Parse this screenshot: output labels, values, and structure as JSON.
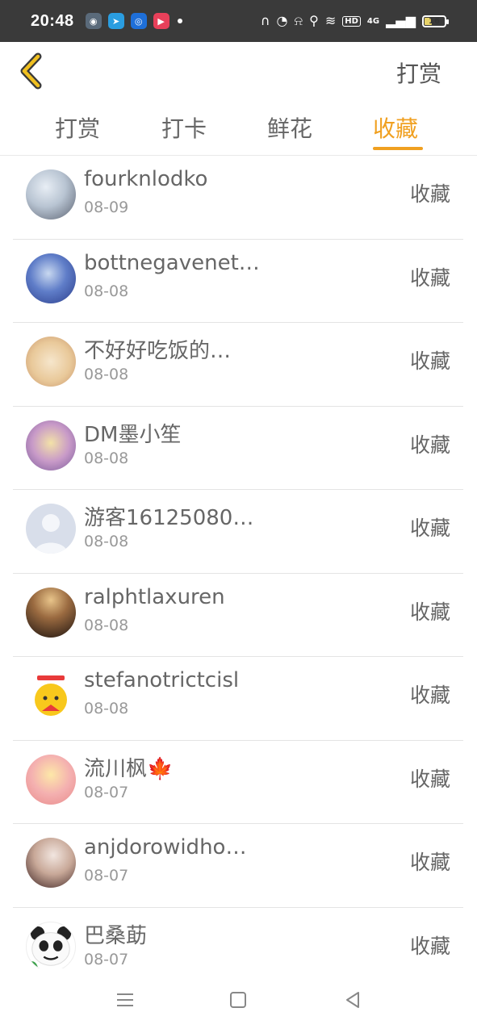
{
  "status_bar": {
    "time": "20:48",
    "network": "4G",
    "hd": "HD",
    "battery": "16"
  },
  "header": {
    "title": "打赏"
  },
  "tabs": [
    {
      "label": "打赏"
    },
    {
      "label": "打卡"
    },
    {
      "label": "鲜花"
    },
    {
      "label": "收藏",
      "active": true
    }
  ],
  "list": [
    {
      "name": "fourknlodko",
      "date": "08-09",
      "action": "收藏"
    },
    {
      "name": "bottnegavenet…",
      "date": "08-08",
      "action": "收藏"
    },
    {
      "name": "不好好吃饭的…",
      "date": "08-08",
      "action": "收藏"
    },
    {
      "name": "DM墨小笙",
      "date": "08-08",
      "action": "收藏"
    },
    {
      "name": "游客16125080…",
      "date": "08-08",
      "action": "收藏"
    },
    {
      "name": "ralphtlaxuren",
      "date": "08-08",
      "action": "收藏"
    },
    {
      "name": "stefanotrictcisl",
      "date": "08-08",
      "action": "收藏"
    },
    {
      "name": "流川枫🍁",
      "date": "08-07",
      "action": "收藏"
    },
    {
      "name": "anjdorowidho…",
      "date": "08-07",
      "action": "收藏"
    },
    {
      "name": "巴桑莇",
      "date": "08-07",
      "action": "收藏"
    }
  ],
  "colors": {
    "accent": "#f0a020",
    "status_bar_bg": "#3a3a3a",
    "text": "#666666",
    "date": "#999999"
  }
}
